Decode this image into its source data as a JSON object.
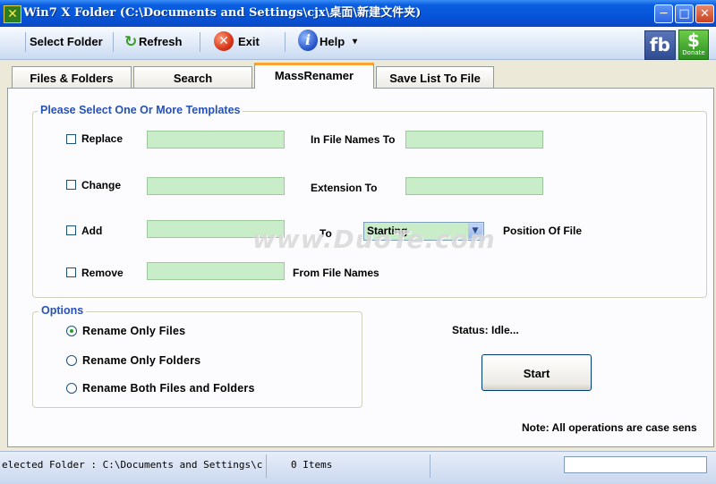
{
  "window": {
    "title": "Win7 X Folder (C:\\Documents and Settings\\cjx\\桌面\\新建文件夹)",
    "app_icon": "✕",
    "controls": {
      "minimize": "─",
      "maximize": "□",
      "close": "✕"
    }
  },
  "toolbar": {
    "select_folder": "Select Folder",
    "refresh": "Refresh",
    "exit": "Exit",
    "help": "Help",
    "help_arrow": "▾",
    "refresh_icon": "↻",
    "exit_icon": "✕",
    "help_icon": "i",
    "facebook": "fb",
    "donate_symbol": "$",
    "donate_text": "Donate"
  },
  "tabs": [
    {
      "label": "Files & Folders",
      "active": false
    },
    {
      "label": "Search",
      "active": false
    },
    {
      "label": "MassRenamer",
      "active": true
    },
    {
      "label": "Save List To File",
      "active": false
    }
  ],
  "templates": {
    "legend": "Please Select One Or More Templates",
    "replace": {
      "label": "Replace",
      "value": "",
      "suffix": "In File Names To",
      "value2": ""
    },
    "change": {
      "label": "Change",
      "value": "",
      "suffix": "Extension To",
      "value2": ""
    },
    "add": {
      "label": "Add",
      "value": "",
      "to": "To",
      "position": "Starting",
      "suffix": "Position Of File"
    },
    "remove": {
      "label": "Remove",
      "value": "",
      "suffix": "From File Names"
    }
  },
  "options": {
    "legend": "Options",
    "items": [
      {
        "label": "Rename Only Files",
        "selected": true
      },
      {
        "label": "Rename Only Folders",
        "selected": false
      },
      {
        "label": "Rename Both Files and Folders",
        "selected": false
      }
    ]
  },
  "status": "Status: Idle...",
  "start_label": "Start",
  "note": "Note: All operations are case sens",
  "watermark": "www.DuoTe.com",
  "statusbar": {
    "selected_folder": "elected Folder : C:\\Documents and Settings\\cjx\\桌面",
    "items": "0 Items"
  },
  "colors": {
    "titlebar": "#0655d9",
    "legend": "#2551b8",
    "field": "#c9ecc9",
    "tab_accent": "#f7a435"
  }
}
